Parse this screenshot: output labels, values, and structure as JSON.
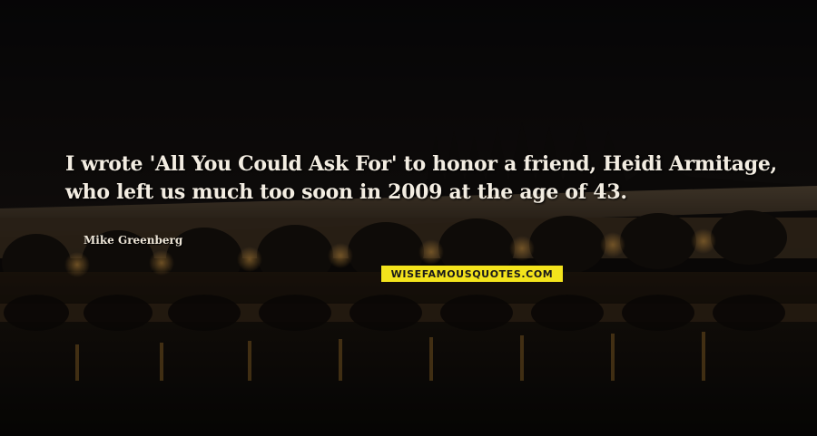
{
  "quote": {
    "line1": "I wrote 'All You Could Ask For' to honor a friend, Heidi Armitage,",
    "line2": "who left us much too soon in 2009 at the age of 43."
  },
  "author": "Mike Greenberg",
  "watermark": "WISEFAMOUSQUOTES.COM",
  "colors": {
    "text": "#f3ede2",
    "watermark_bg": "#f3e31c",
    "background": "#0e0c0c",
    "light_glow": "#d89a3a"
  }
}
